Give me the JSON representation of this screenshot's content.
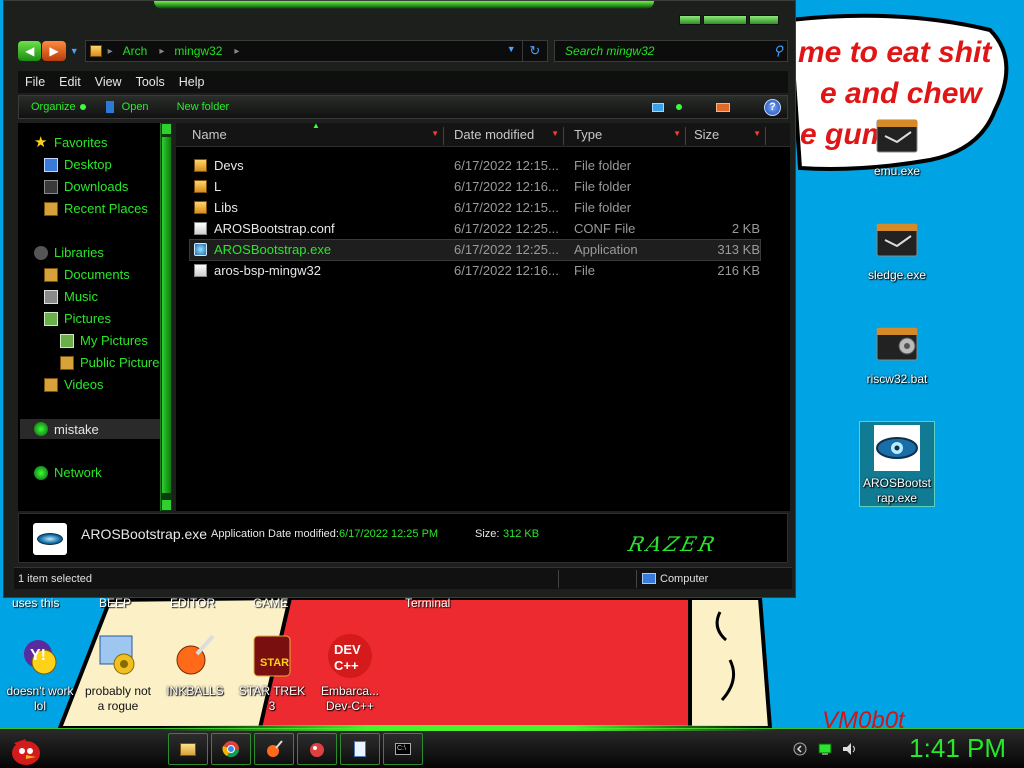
{
  "window": {
    "address": {
      "parts": [
        "Arch",
        "mingw32"
      ]
    },
    "search": {
      "placeholder": "Search mingw32"
    },
    "menu": [
      "File",
      "Edit",
      "View",
      "Tools",
      "Help"
    ],
    "commands": {
      "organize": "Organize",
      "open": "Open",
      "new_folder": "New folder",
      "help": "?"
    },
    "nav": {
      "favorites": "Favorites",
      "desktop": "Desktop",
      "downloads": "Downloads",
      "recent": "Recent Places",
      "libraries": "Libraries",
      "documents": "Documents",
      "music": "Music",
      "pictures": "Pictures",
      "my_pictures": "My Pictures",
      "public_pictures": "Public Picture",
      "videos": "Videos",
      "mistake": "mistake",
      "network": "Network"
    },
    "columns": {
      "name": "Name",
      "date": "Date modified",
      "type": "Type",
      "size": "Size"
    },
    "files": [
      {
        "name": "Devs",
        "date": "6/17/2022 12:15...",
        "type": "File folder",
        "size": "",
        "icon": "folder-icon"
      },
      {
        "name": "L",
        "date": "6/17/2022 12:16...",
        "type": "File folder",
        "size": "",
        "icon": "folder-icon"
      },
      {
        "name": "Libs",
        "date": "6/17/2022 12:15...",
        "type": "File folder",
        "size": "",
        "icon": "folder-icon"
      },
      {
        "name": "AROSBootstrap.conf",
        "date": "6/17/2022 12:25...",
        "type": "CONF File",
        "size": "2 KB",
        "icon": "file-icon"
      },
      {
        "name": "AROSBootstrap.exe",
        "date": "6/17/2022 12:25...",
        "type": "Application",
        "size": "313 KB",
        "icon": "app-icon"
      },
      {
        "name": "aros-bsp-mingw32",
        "date": "6/17/2022 12:16...",
        "type": "File",
        "size": "216 KB",
        "icon": "file-icon"
      }
    ],
    "details": {
      "name": "AROSBootstrap.exe",
      "type": "Application",
      "modified_label": "Date modified:",
      "modified_value": "6/17/2022 12:25 PM",
      "size_label": "Size:",
      "size_value": "312 KB",
      "brand": "RAZER"
    },
    "status": {
      "count": "1 item selected",
      "location": "Computer"
    }
  },
  "desktop": {
    "wallpaper_text": [
      "me to eat shit",
      "e and chew",
      "e gum"
    ],
    "watermark": "VM0b0t",
    "right_icons": [
      "emu.exe",
      "sledge.exe",
      "riscw32.bat",
      "AROSBootstrap.exe"
    ],
    "cut_labels": [
      "uses this",
      "BEEP",
      "EDITOR",
      "GAME",
      "Terminal"
    ],
    "bottom_icons": [
      {
        "line1": "doesn't work",
        "line2": "lol"
      },
      {
        "line1": "probably not",
        "line2": "a rogue"
      },
      {
        "line1": "INKBALLS",
        "line2": ""
      },
      {
        "line1": "STAR TREK",
        "line2": "3"
      },
      {
        "line1": "Embarca...",
        "line2": "Dev-C++"
      }
    ]
  },
  "taskbar": {
    "clock": "1:41 PM"
  },
  "colors": {
    "accent": "#2ae62a",
    "desktop": "#00a4e4",
    "window": "#000000"
  }
}
